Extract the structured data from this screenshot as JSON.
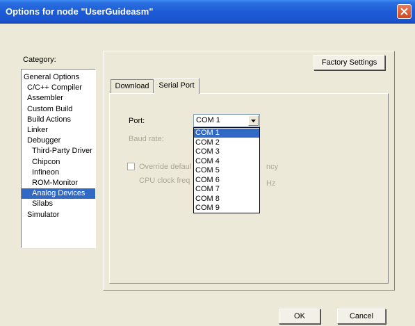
{
  "window": {
    "title": "Options for node \"UserGuideasm\""
  },
  "category": {
    "label": "Category:",
    "items": [
      {
        "label": "General Options",
        "level": 0
      },
      {
        "label": "C/C++ Compiler",
        "level": 1
      },
      {
        "label": "Assembler",
        "level": 1
      },
      {
        "label": "Custom Build",
        "level": 1
      },
      {
        "label": "Build Actions",
        "level": 1
      },
      {
        "label": "Linker",
        "level": 1
      },
      {
        "label": "Debugger",
        "level": 1
      },
      {
        "label": "Third-Party Driver",
        "level": 2
      },
      {
        "label": "Chipcon",
        "level": 2
      },
      {
        "label": "Infineon",
        "level": 2
      },
      {
        "label": "ROM-Monitor",
        "level": 2
      },
      {
        "label": "Analog Devices",
        "level": 2,
        "selected": true
      },
      {
        "label": "Silabs",
        "level": 2
      },
      {
        "label": "Simulator",
        "level": 1
      }
    ]
  },
  "buttons": {
    "factory_settings": "Factory Settings",
    "ok": "OK",
    "cancel": "Cancel"
  },
  "tabs": [
    {
      "label": "Download",
      "active": false
    },
    {
      "label": "Serial Port",
      "active": true
    }
  ],
  "serial_port": {
    "port_label": "Port:",
    "port_value": "COM 1",
    "baud_label": "Baud rate:",
    "override_label_start": "Override defaul",
    "override_label_end": "ncy",
    "cpu_label_start": "CPU clock freq",
    "cpu_unit": "Hz",
    "options": [
      "COM 1",
      "COM 2",
      "COM 3",
      "COM 4",
      "COM 5",
      "COM 6",
      "COM 7",
      "COM 8",
      "COM 9"
    ],
    "highlighted_index": 0
  },
  "colors": {
    "titlebar": "#1D5BD6",
    "selection": "#316AC5",
    "close": "#D4481E"
  }
}
